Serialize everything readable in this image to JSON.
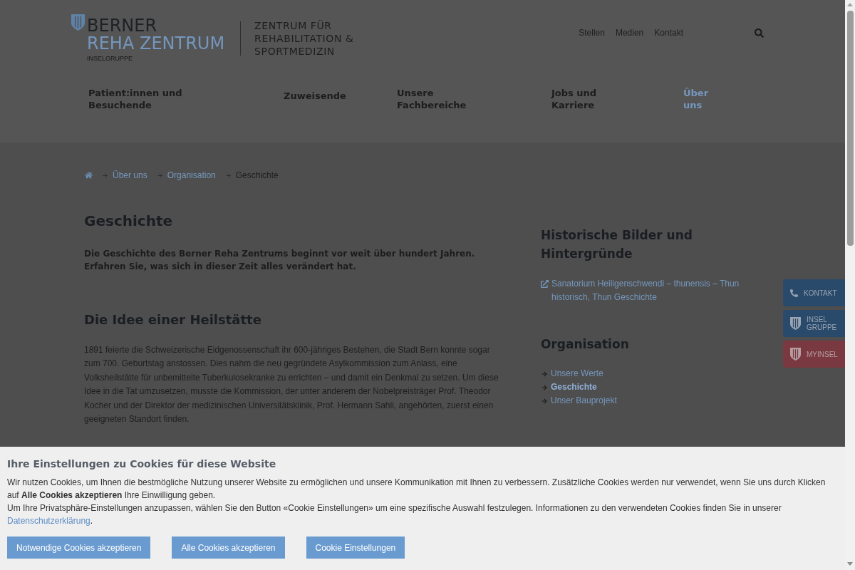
{
  "header": {
    "logo": {
      "line_1": "BERNER",
      "line_2": "REHA ZENTRUM",
      "line_3": "INSELGRUPPE"
    },
    "tagline": [
      "ZENTRUM FÜR",
      "REHABILITATION &",
      "SPORTMEDIZIN"
    ],
    "top_links": [
      "Stellen",
      "Medien",
      "Kontakt"
    ]
  },
  "nav": {
    "items": [
      {
        "label": "Patient:innen und Besuchende",
        "selected": false
      },
      {
        "label": "Zuweisende",
        "selected": false
      },
      {
        "label": "Unsere Fachbereiche",
        "selected": false
      },
      {
        "label": "Jobs und Karriere",
        "selected": false
      },
      {
        "label": "Über uns",
        "selected": true
      }
    ]
  },
  "breadcrumb": [
    {
      "label": "Über uns",
      "kind": "link"
    },
    {
      "label": "Organisation",
      "kind": "link"
    },
    {
      "label": "Geschichte",
      "kind": "current"
    }
  ],
  "main": {
    "title": "Geschichte",
    "intro": "Die Geschichte des Berner Reha Zentrums beginnt vor weit über hundert Jahren. Erfahren Sie, was sich in dieser Zeit alles verändert hat.",
    "sections": [
      {
        "heading": "Die Idee einer Heilstätte",
        "text": "1891 feierte die Schweizerische Eidgenossenschaft ihr 600-jähriges Bestehen, die Stadt Bern konnte sogar zum 700. Geburtstag anstossen. Dies nahm die neu gegründete Asylkommission zum Anlass, eine Volksheilstätte für unbemittelte Tuberkulosekranke zu errichten – und damit ein Denkmal zu setzen. Um diese Idee in die Tat umzusetzen, musste die Kommission, der unter anderem der Nobelpreisträger Prof. Theodor Kocher und der Direktor der medizinischen Universitätsklinik, Prof. Hermann Sahli, angehörten, zuerst einen geeigneten Standort finden."
      }
    ]
  },
  "sidebar": {
    "sections": [
      {
        "heading": "Historische Bilder und Hintergründe",
        "links": [
          {
            "label": "Sanatorium Heiligenschwendi – thunensis – Thun historisch, Thun Geschichte",
            "kind": "external"
          }
        ]
      },
      {
        "heading": "Organisation",
        "links": [
          {
            "label": "Unsere Werte",
            "kind": "arrow",
            "selected": false
          },
          {
            "label": "Geschichte",
            "kind": "arrow",
            "selected": true
          },
          {
            "label": "Unser Bauprojekt",
            "kind": "arrow",
            "selected": false
          }
        ]
      }
    ]
  },
  "side_tabs": [
    {
      "label": "KONTAKT",
      "kind": "phone",
      "color": "#2a4a6c"
    },
    {
      "label": "INSEL GRUPPE",
      "kind": "shield",
      "color": "#2a4a6c"
    },
    {
      "label": "MYINSEL",
      "kind": "shield",
      "color": "#7a3840"
    }
  ],
  "cookie_banner": {
    "title": "Ihre Einstellungen zu Cookies für diese Website",
    "paragraphs": [
      {
        "text": "Wir nutzen Cookies, um Ihnen die bestmögliche Nutzung unserer Website zu ermöglichen und unsere Kommunikation mit Ihnen zu verbessern. Zusätzliche Cookies werden nur verwendet, wenn Sie uns durch Klicken auf **Alle Cookies akzeptieren** Ihre Einwilligung geben."
      },
      {
        "text": "Um Ihre Privatsphäre-Einstellungen anzupassen, wählen Sie den Button «Cookie Einstellungen» um eine spezifische Auswahl festzulegen. Informationen zu den verwendeten Cookies finden Sie in unserer",
        "link": "Datenschutzerklärung",
        "after": "."
      }
    ],
    "buttons": [
      "Notwendige Cookies akzeptieren",
      "Alle Cookies akzeptieren",
      "Cookie Einstellungen"
    ]
  }
}
